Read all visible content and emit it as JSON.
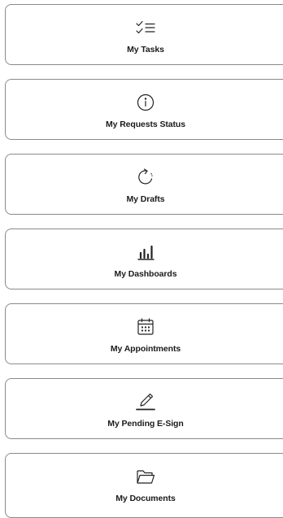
{
  "menu": {
    "items": [
      {
        "label": "My Tasks",
        "icon": "checklist-icon"
      },
      {
        "label": "My Requests Status",
        "icon": "info-icon"
      },
      {
        "label": "My Drafts",
        "icon": "refresh-icon"
      },
      {
        "label": "My Dashboards",
        "icon": "bar-chart-icon"
      },
      {
        "label": "My Appointments",
        "icon": "calendar-icon"
      },
      {
        "label": "My Pending E-Sign",
        "icon": "signature-pen-icon"
      },
      {
        "label": "My Documents",
        "icon": "folder-icon"
      }
    ]
  },
  "colors": {
    "border": "#8a8a8a",
    "text": "#1b1b1b",
    "icon": "#222222",
    "background": "#ffffff"
  }
}
